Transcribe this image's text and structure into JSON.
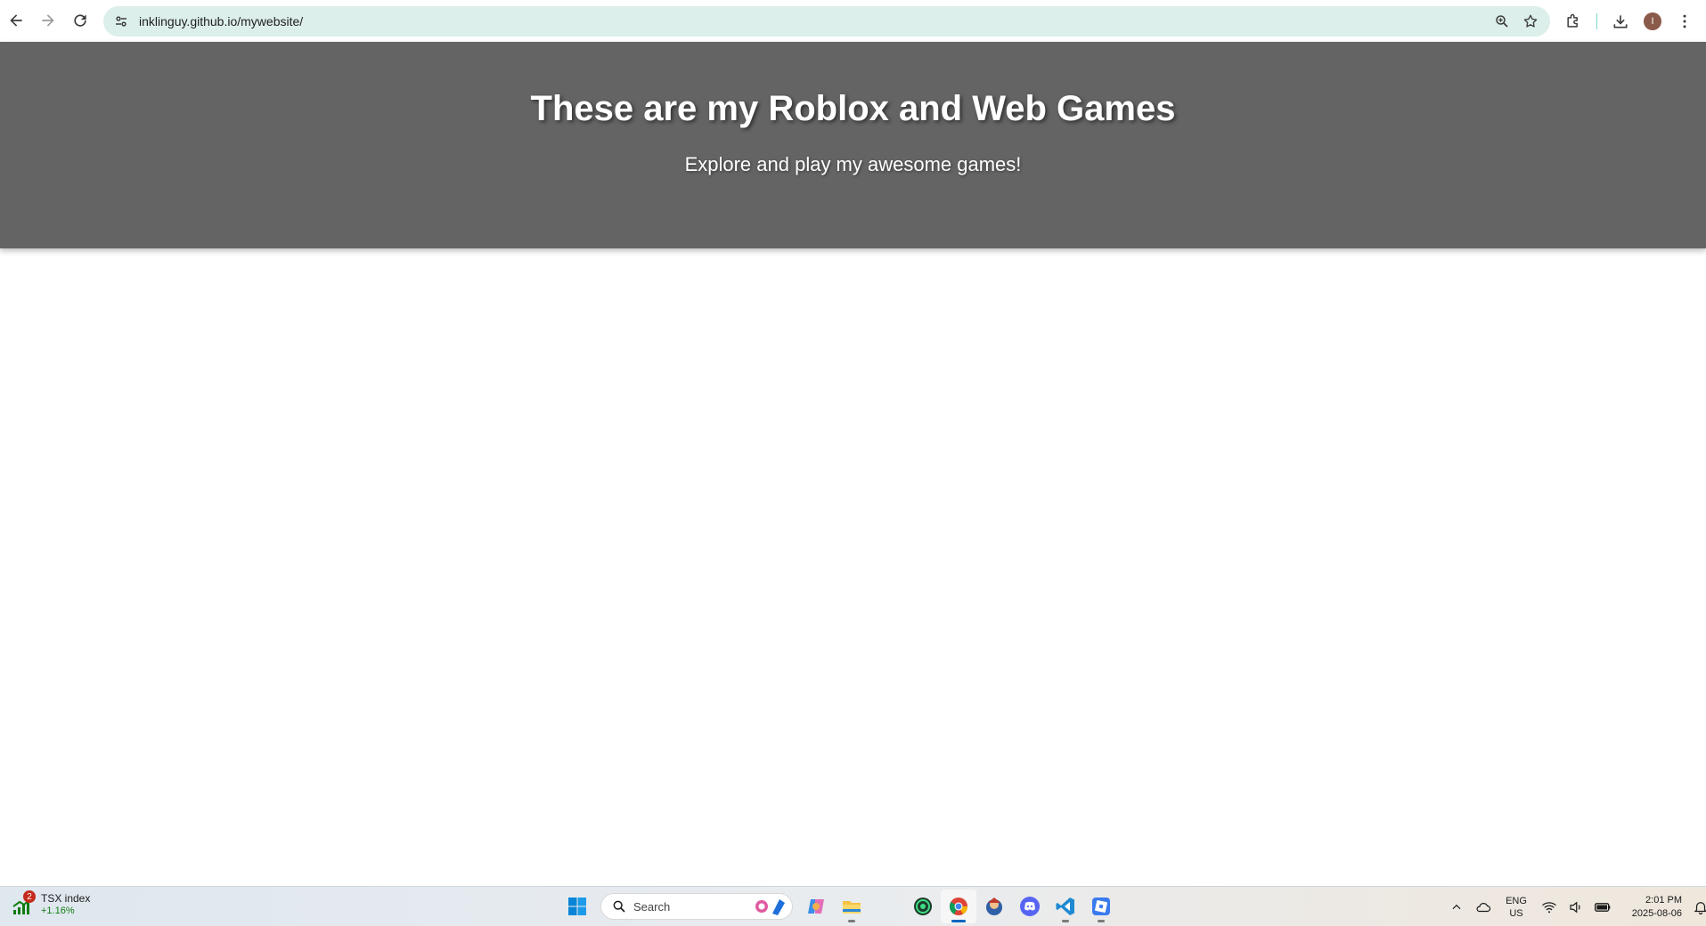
{
  "browser": {
    "url": "inklinguy.github.io/mywebsite/",
    "avatar_initial": "I",
    "accent": "#dcefeb"
  },
  "page": {
    "title": "These are my Roblox and Web Games",
    "subtitle": "Explore and play my awesome games!",
    "hero_color": "#646464"
  },
  "taskbar": {
    "widget": {
      "title": "TSX index",
      "change": "+1.16%",
      "badge": "2"
    },
    "search_placeholder": "Search",
    "apps": [
      "start-icon",
      "copilot-icon",
      "file-explorer-icon",
      "app-green-icon",
      "chrome-icon",
      "game-app-icon",
      "discord-icon",
      "vscode-icon",
      "roblox-icon"
    ],
    "tray": {
      "lang_line1": "ENG",
      "lang_line2": "US",
      "time": "2:01 PM",
      "date": "2025-08-06"
    }
  }
}
